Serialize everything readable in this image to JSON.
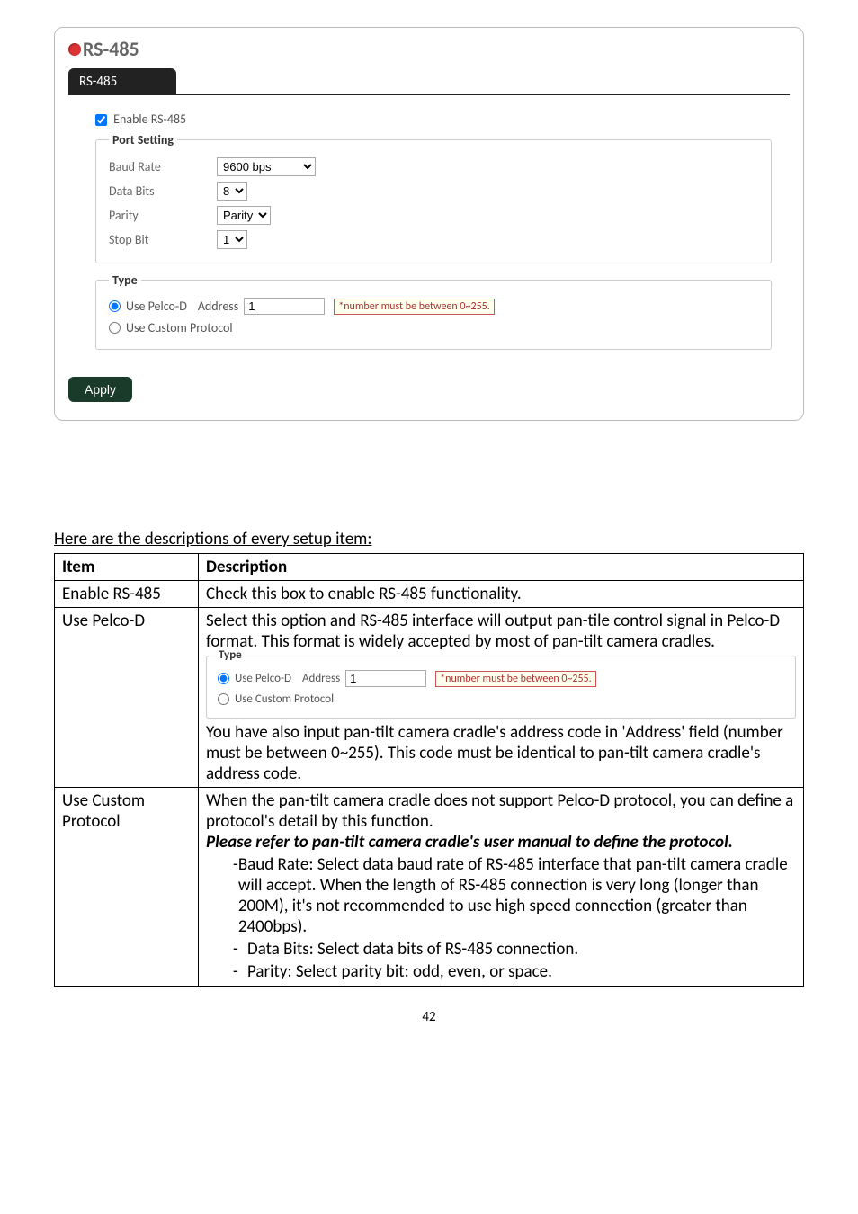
{
  "panel": {
    "title": "RS-485",
    "tab": "RS-485",
    "enable_label": "Enable RS-485",
    "port_setting_legend": "Port Setting",
    "baud_label": "Baud Rate",
    "baud_value": "9600 bps",
    "data_bits_label": "Data Bits",
    "data_bits_value": "8",
    "parity_label": "Parity",
    "parity_value": "Parity",
    "stop_bit_label": "Stop Bit",
    "stop_bit_value": "1",
    "type_legend": "Type",
    "pelco_label": "Use Pelco-D",
    "address_label": "Address",
    "address_value": "1",
    "warn": "*number must be between 0~255.",
    "custom_label": "Use Custom Protocol",
    "apply": "Apply"
  },
  "intro": "Here are the descriptions of every setup item:",
  "table": {
    "h_item": "Item",
    "h_desc": "Description",
    "r1_item": "Enable RS-485",
    "r1_desc": "Check this box to enable RS-485 functionality.",
    "r2_item": "Use Pelco-D",
    "r2_p1": "Select this option and RS-485 interface will output pan-tile control signal in Pelco-D format. This format is widely accepted by most of pan-tilt camera cradles.",
    "r2_p2a": "You have also input pan-tilt camera cradle's address code in 'Address' field (number must be between 0~255). This code must be identical to pan-tilt camera cradle's address code.",
    "r3_item": "Use Custom Protocol",
    "r3_p1": "When the pan-tilt camera cradle does not support Pelco-D protocol, you can define a protocol's detail by this function.",
    "r3_p2": "Please refer to pan-tilt camera cradle's user manual to define the protocol.",
    "r3_b1": "Baud Rate: Select data baud rate of RS-485 interface that pan-tilt camera cradle will accept. When the length of RS-485 connection is very long (longer than 200M), it's not recommended to use high speed connection (greater than 2400bps).",
    "r3_b2": "Data Bits: Select data bits of RS-485 connection.",
    "r3_b3": "Parity: Select parity bit: odd, even, or space."
  },
  "inner_type": {
    "legend": "Type",
    "pelco": "Use Pelco-D",
    "addr_lbl": "Address",
    "addr_val": "1",
    "warn": "*number must be between 0~255.",
    "custom": "Use Custom Protocol"
  },
  "page": "42"
}
